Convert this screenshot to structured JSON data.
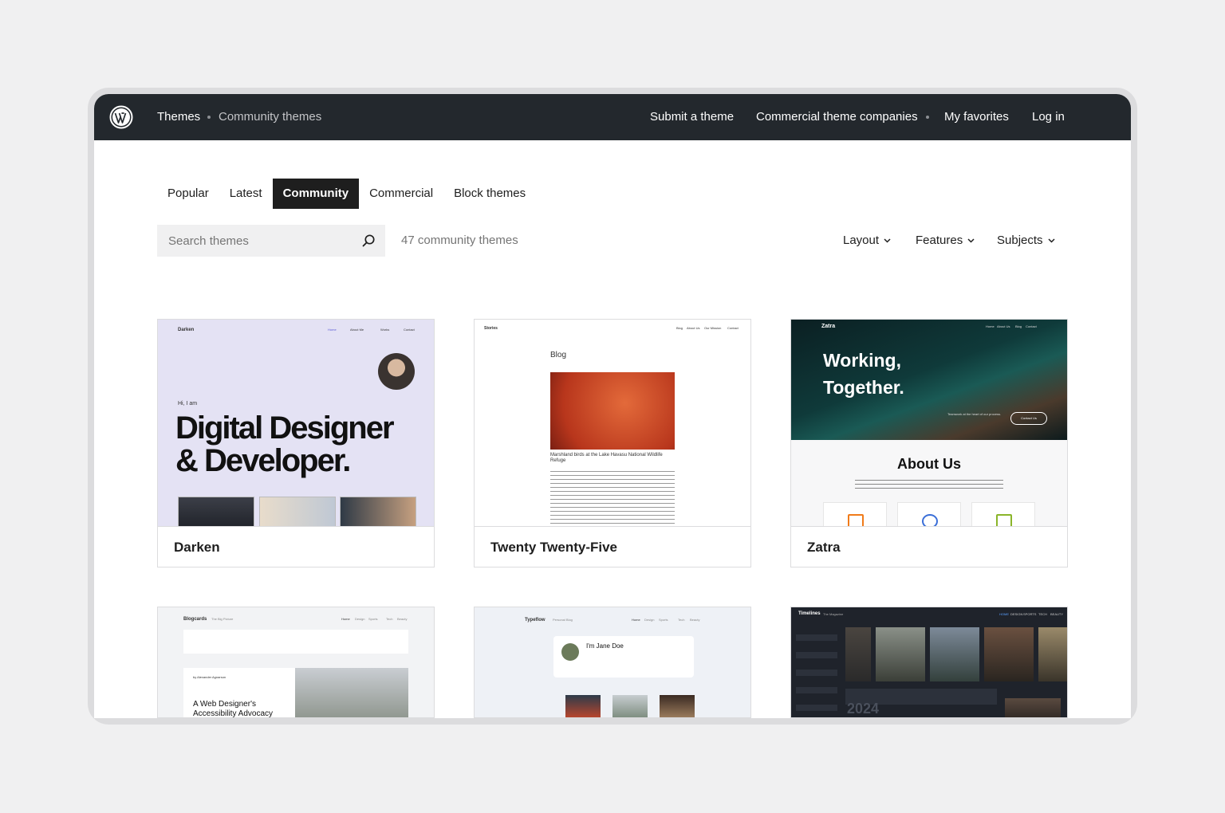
{
  "topbar": {
    "breadcrumb": [
      "Themes",
      "Community themes"
    ],
    "nav": [
      "Submit a theme",
      "Commercial theme companies",
      "My favorites",
      "Log in"
    ]
  },
  "tabs": [
    {
      "label": "Popular",
      "active": false
    },
    {
      "label": "Latest",
      "active": false
    },
    {
      "label": "Community",
      "active": true
    },
    {
      "label": "Commercial",
      "active": false
    },
    {
      "label": "Block themes",
      "active": false
    }
  ],
  "search": {
    "placeholder": "Search themes",
    "value": ""
  },
  "result_count": "47 community themes",
  "filters": [
    "Layout",
    "Features",
    "Subjects"
  ],
  "themes": [
    {
      "name": "Darken",
      "preview": {
        "site": "Darken",
        "nav": [
          "Home",
          "About Me",
          "Works",
          "Contact"
        ],
        "kicker": "Hi, I am",
        "headline_1": "Digital Designer",
        "headline_2": "& Developer."
      }
    },
    {
      "name": "Twenty Twenty-Five",
      "preview": {
        "site": "Stories",
        "nav": [
          "Blog",
          "About Us",
          "Our Mission",
          "Contact"
        ],
        "heading": "Blog",
        "caption": "Marshland birds at the Lake Havasu National Wildlife Refuge"
      }
    },
    {
      "name": "Zatra",
      "preview": {
        "site": "Zatra",
        "nav": [
          "Home",
          "About Us",
          "Blog",
          "Contact"
        ],
        "hero_1": "Working,",
        "hero_2": "Together.",
        "hero_small": "Teamwork at the heart of our process.",
        "hero_button": "Contact Us",
        "section_title": "About Us"
      }
    },
    {
      "name": "Blogcards",
      "preview": {
        "site": "Blogcards",
        "tagline": "The Big Picture",
        "nav": [
          "Home",
          "Design",
          "Sports",
          "Tech",
          "Beauty"
        ],
        "author": "by Alexander Agnarson",
        "headline_1": "A Web Designer's",
        "headline_2": "Accessibility Advocacy"
      }
    },
    {
      "name": "Typeflow",
      "preview": {
        "site": "Typeflow",
        "tagline": "Personal Blog",
        "nav": [
          "Home",
          "Design",
          "Sports",
          "Tech",
          "Beauty"
        ],
        "profile_name": "I'm Jane Doe"
      }
    },
    {
      "name": "Timelines",
      "preview": {
        "site": "Timelines",
        "tagline": "The Magazine",
        "nav": [
          "HOME",
          "DESIGN",
          "SPORTS",
          "TECH",
          "BEAUTY"
        ],
        "year": "2024"
      }
    }
  ],
  "colors": {
    "topbar": "#23282d",
    "accent_active_tab": "#1e1e1e",
    "page_bg": "#f0f0f1"
  }
}
